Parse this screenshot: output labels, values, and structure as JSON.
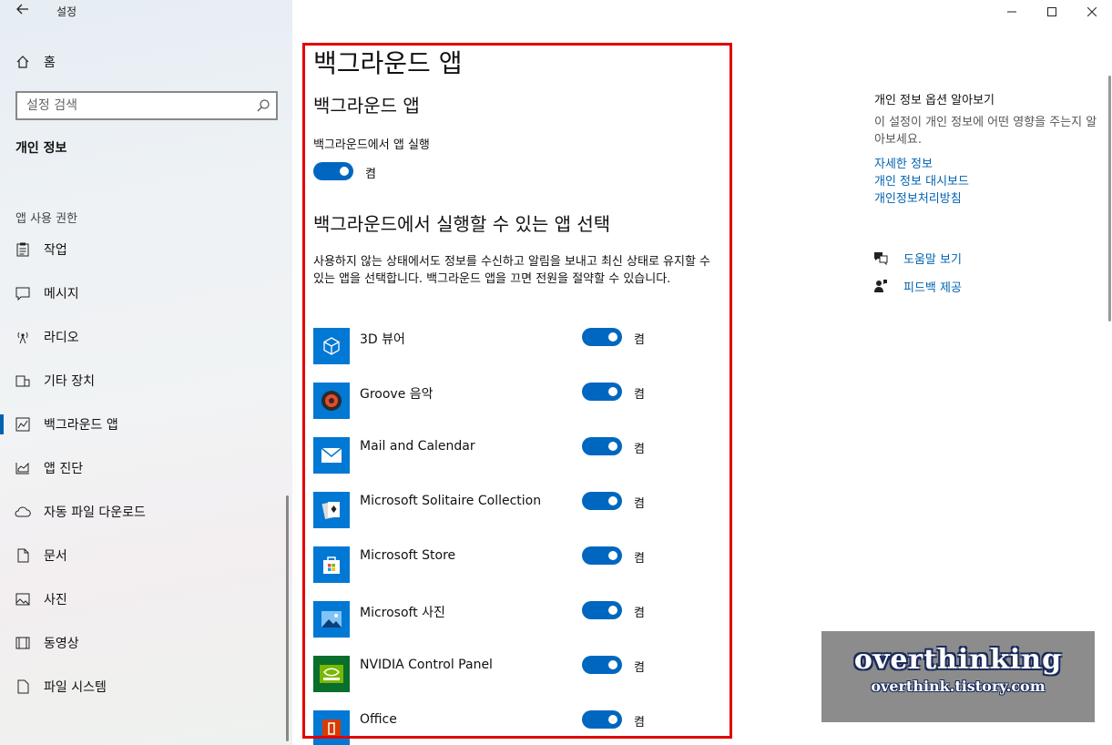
{
  "window": {
    "title": "설정",
    "back_icon": "back-arrow-icon"
  },
  "sidebar": {
    "home_label": "홈",
    "search_placeholder": "설정 검색",
    "section_title": "개인 정보",
    "group_label": "앱 사용 권한",
    "items": [
      {
        "label": "작업",
        "icon": "clipboard-icon"
      },
      {
        "label": "메시지",
        "icon": "chat-icon"
      },
      {
        "label": "라디오",
        "icon": "radio-icon"
      },
      {
        "label": "기타 장치",
        "icon": "devices-icon"
      },
      {
        "label": "백그라운드 앱",
        "icon": "background-apps-icon",
        "selected": true
      },
      {
        "label": "앱 진단",
        "icon": "diagnostics-icon"
      },
      {
        "label": "자동 파일 다운로드",
        "icon": "cloud-icon"
      },
      {
        "label": "문서",
        "icon": "document-icon"
      },
      {
        "label": "사진",
        "icon": "picture-icon"
      },
      {
        "label": "동영상",
        "icon": "video-icon"
      },
      {
        "label": "파일 시스템",
        "icon": "file-icon"
      }
    ]
  },
  "main": {
    "page_title": "백그라운드 앱",
    "sub_title": "백그라운드 앱",
    "run_label": "백그라운드에서 앱 실행",
    "run_toggle_state": "켬",
    "select_title": "백그라운드에서 실행할 수 있는 앱 선택",
    "description": "사용하지 않는 상태에서도 정보를 수신하고 알림을 보내고 최신 상태로 유지할 수 있는 앱을 선택합니다. 백그라운드 앱을 끄면 전원을 절약할 수 있습니다.",
    "apps": [
      {
        "name": "3D 뷰어",
        "state": "켬",
        "icon": "cube-icon"
      },
      {
        "name": "Groove 음악",
        "state": "켬",
        "icon": "groove-disc-icon"
      },
      {
        "name": "Mail and Calendar",
        "state": "켬",
        "icon": "mail-icon"
      },
      {
        "name": "Microsoft Solitaire Collection",
        "state": "켬",
        "icon": "cards-icon"
      },
      {
        "name": "Microsoft Store",
        "state": "켬",
        "icon": "store-bag-icon"
      },
      {
        "name": "Microsoft 사진",
        "state": "켬",
        "icon": "photos-icon"
      },
      {
        "name": "NVIDIA Control Panel",
        "state": "켬",
        "icon": "nvidia-icon"
      },
      {
        "name": "Office",
        "state": "켬",
        "icon": "office-icon"
      }
    ]
  },
  "right_panel": {
    "title": "개인 정보 옵션 알아보기",
    "description": "이 설정이 개인 정보에 어떤 영향을 주는지 알아보세요.",
    "links": [
      "자세한 정보",
      "개인 정보 대시보드",
      "개인정보처리방침"
    ],
    "help_label": "도움말 보기",
    "feedback_label": "피드백 제공"
  },
  "watermark": {
    "line1": "overthinking",
    "line2": "overthink.tistory.com"
  },
  "colors": {
    "accent": "#0067c0",
    "tile": "#0078d4",
    "link": "#0063b1",
    "highlight_box": "#e00000"
  }
}
